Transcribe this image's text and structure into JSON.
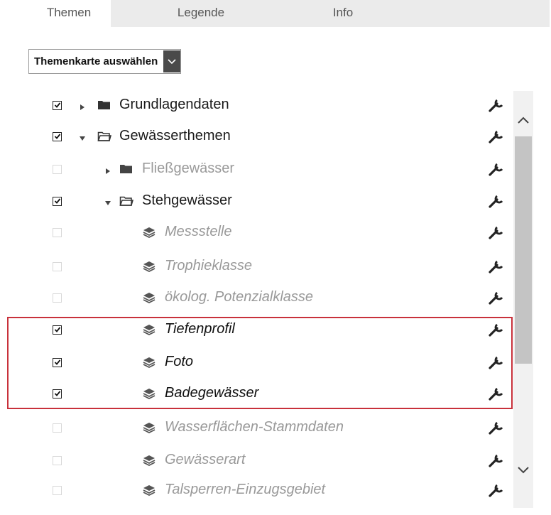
{
  "tabs": [
    {
      "label": "Themen"
    },
    {
      "label": "Legende"
    },
    {
      "label": "Info"
    }
  ],
  "theme_select": {
    "label": "Themenkarte auswählen"
  },
  "tree": [
    {
      "label": "Grundlagendaten",
      "checked": true,
      "kind": "folder",
      "state": "collapsed",
      "style": "active"
    },
    {
      "label": "Gewässerthemen",
      "checked": true,
      "kind": "folder",
      "state": "expanded",
      "style": "active"
    },
    {
      "label": "Fließgewässer",
      "checked": false,
      "kind": "folder",
      "state": "collapsed",
      "style": "inactive"
    },
    {
      "label": "Stehgewässer",
      "checked": true,
      "kind": "folder",
      "state": "expanded",
      "style": "active"
    },
    {
      "label": "Messstelle",
      "checked": false,
      "kind": "layer",
      "style": "inactive"
    },
    {
      "label": "Trophieklasse",
      "checked": false,
      "kind": "layer",
      "style": "inactive"
    },
    {
      "label": "ökolog. Potenzialklasse",
      "checked": false,
      "kind": "layer",
      "style": "inactive"
    },
    {
      "label": "Tiefenprofil",
      "checked": true,
      "kind": "layer",
      "style": "active"
    },
    {
      "label": "Foto",
      "checked": true,
      "kind": "layer",
      "style": "active"
    },
    {
      "label": "Badegewässer",
      "checked": true,
      "kind": "layer",
      "style": "active"
    },
    {
      "label": "Wasserflächen-Stammdaten",
      "checked": false,
      "kind": "layer",
      "style": "inactive"
    },
    {
      "label": "Gewässerart",
      "checked": false,
      "kind": "layer",
      "style": "inactive"
    },
    {
      "label": "Talsperren-Einzugsgebiet",
      "checked": false,
      "kind": "layer",
      "style": "inactive"
    }
  ],
  "colors": {
    "highlight_border": "#c8313b",
    "select_button": "#4a4a4a"
  }
}
